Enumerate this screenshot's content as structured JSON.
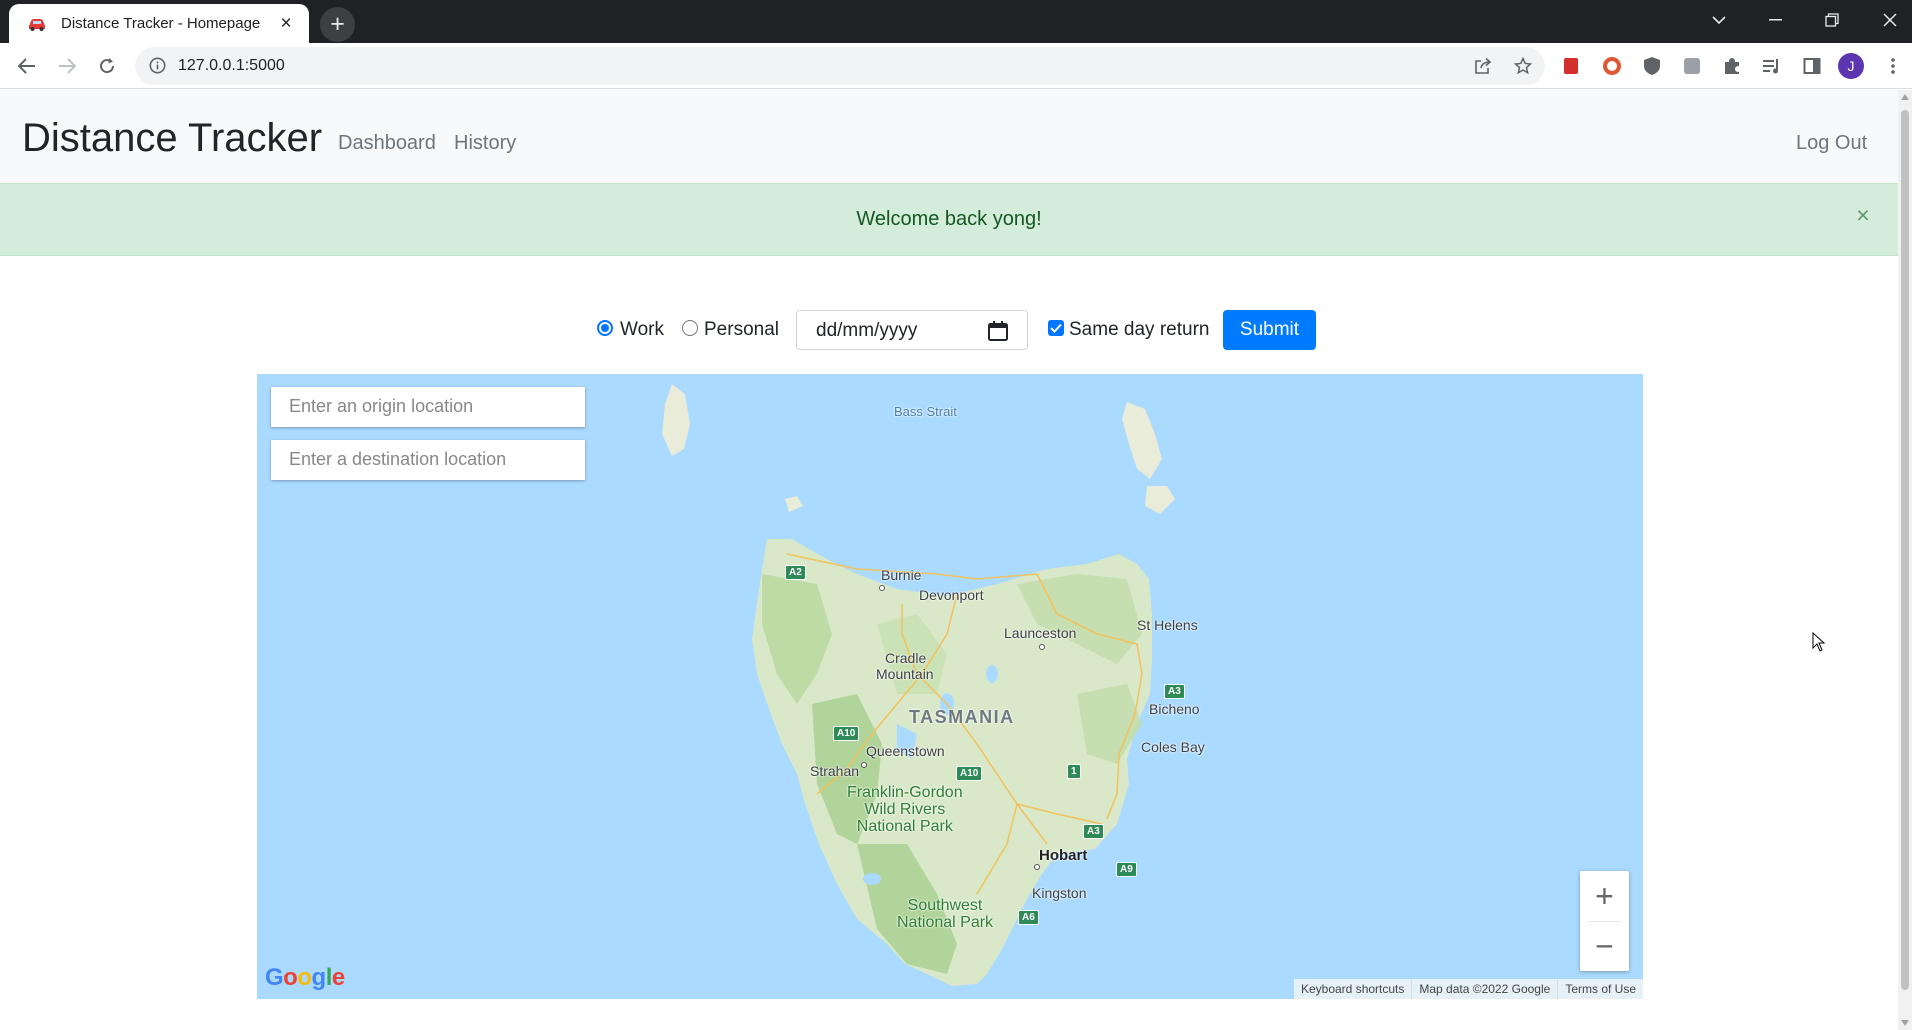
{
  "browser": {
    "tab_title": "Distance Tracker - Homepage",
    "url": "127.0.0.1:5000",
    "profile_initial": "J"
  },
  "navbar": {
    "brand": "Distance Tracker",
    "links": [
      "Dashboard",
      "History"
    ],
    "logout": "Log Out"
  },
  "alert": {
    "message": "Welcome back yong!",
    "close": "×"
  },
  "form": {
    "trip_types": [
      {
        "label": "Work",
        "checked": true
      },
      {
        "label": "Personal",
        "checked": false
      }
    ],
    "date_placeholder": "dd/mm/yyyy",
    "same_day_return_label": "Same day return",
    "same_day_return_checked": true,
    "submit_label": "Submit"
  },
  "map": {
    "origin_placeholder": "Enter an origin location",
    "destination_placeholder": "Enter a destination location",
    "labels": {
      "bass_strait": "Bass Strait",
      "burnie": "Burnie",
      "devonport": "Devonport",
      "launceston": "Launceston",
      "st_helens": "St Helens",
      "cradle": "Cradle",
      "mountain": "Mountain",
      "tasmania": "TASMANIA",
      "bicheno": "Bicheno",
      "coles_bay": "Coles Bay",
      "queenstown": "Queenstown",
      "strahan": "Strahan",
      "franklin_1": "Franklin-Gordon",
      "franklin_2": "Wild Rivers",
      "franklin_3": "National Park",
      "hobart": "Hobart",
      "kingston": "Kingston",
      "southwest_1": "Southwest",
      "southwest_2": "National Park"
    },
    "shields": {
      "a2": "A2",
      "a10a": "A10",
      "a10b": "A10",
      "a3a": "A3",
      "a3b": "A3",
      "a9": "A9",
      "a6": "A6",
      "one": "1"
    },
    "zoom_in": "+",
    "zoom_out": "−",
    "logo": "Google",
    "attribution": [
      "Keyboard shortcuts",
      "Map data ©2022 Google",
      "Terms of Use"
    ]
  },
  "colors": {
    "primary": "#007bff",
    "alert_bg": "#d4edda",
    "alert_text": "#155724",
    "water": "#aadaff",
    "land": "#d7e8c4"
  }
}
